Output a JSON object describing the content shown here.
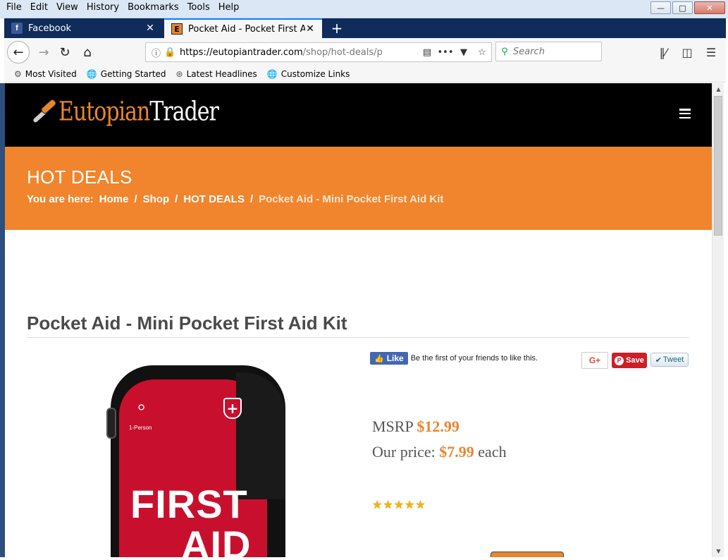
{
  "menu": [
    "File",
    "Edit",
    "View",
    "History",
    "Bookmarks",
    "Tools",
    "Help"
  ],
  "tabs": [
    {
      "title": "Facebook",
      "favicon": "f"
    },
    {
      "title": "Pocket Aid - Pocket First Aid Kit",
      "favicon": "E"
    }
  ],
  "url": {
    "host": "https://eutopiantrader.com",
    "path": "/shop/hot-deals/p"
  },
  "search": {
    "placeholder": "Search"
  },
  "bookmarks": [
    "Most Visited",
    "Getting Started",
    "Latest Headlines",
    "Customize Links"
  ],
  "site": {
    "brand_a": "Eutopian",
    "brand_b": "Trader"
  },
  "banner": {
    "title": "HOT DEALS",
    "breadcrumb": {
      "prefix": "You are here:",
      "items": [
        "Home",
        "Shop",
        "HOT DEALS",
        "Pocket Aid - Mini Pocket First Aid Kit"
      ]
    }
  },
  "product": {
    "title": "Pocket Aid - Mini Pocket First Aid Kit",
    "image_text": {
      "line1": "FIRST",
      "line2": "AID",
      "person_label": "1-Person"
    },
    "msrp_label": "MSRP",
    "msrp": "$12.99",
    "price_label": "Our price:",
    "price": "$7.99",
    "price_unit": "each",
    "rating": 5
  },
  "social": {
    "like": "Like",
    "like_text": "Be the first of your friends to like this.",
    "gplus": "G+",
    "save": "Save",
    "tweet": "Tweet"
  },
  "colors": {
    "accent": "#f0852d",
    "header": "#000000",
    "price": "#e8862f"
  }
}
